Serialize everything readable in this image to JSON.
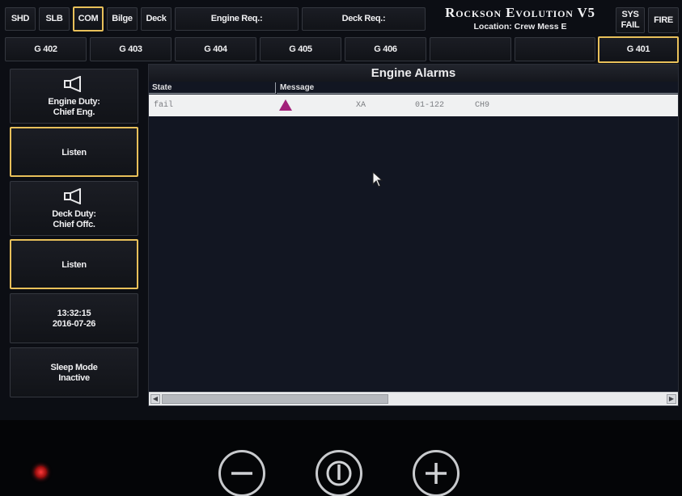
{
  "top_tabs": [
    {
      "label": "SHD",
      "selected": false
    },
    {
      "label": "SLB",
      "selected": false
    },
    {
      "label": "COM",
      "selected": true
    },
    {
      "label": "Bilge",
      "selected": false
    },
    {
      "label": "Deck",
      "selected": false
    }
  ],
  "requests": {
    "engine": "Engine Req.:",
    "deck": "Deck Req.:"
  },
  "brand": {
    "title": "Rockson Evolution V5",
    "location": "Location: Crew Mess E"
  },
  "status_buttons": {
    "sys_fail": "SYS FAIL",
    "fire": "FIRE"
  },
  "groups": [
    {
      "label": "G 402",
      "selected": false
    },
    {
      "label": "G 403",
      "selected": false
    },
    {
      "label": "G 404",
      "selected": false
    },
    {
      "label": "G 405",
      "selected": false
    },
    {
      "label": "G 406",
      "selected": false
    },
    {
      "label": "",
      "selected": false
    },
    {
      "label": "",
      "selected": false
    },
    {
      "label": "G 401",
      "selected": true
    }
  ],
  "sidebar": {
    "engine_duty": "Engine Duty:\nChief Eng.",
    "listen_1": "Listen",
    "deck_duty": "Deck Duty:\nChief Offc.",
    "listen_2": "Listen",
    "datetime": "13:32:15\n2016-07-26",
    "sleep_mode": "Sleep Mode\nInactive"
  },
  "alarms": {
    "title": "Engine Alarms",
    "columns": [
      "State",
      "Message"
    ],
    "rows": [
      {
        "state": "fail",
        "severity_icon": "warning-triangle-icon",
        "code": "XA",
        "location": "01-122",
        "channel": "CH9"
      }
    ]
  },
  "colors": {
    "selected_border": "#e8c05a",
    "alarm_icon": "#a2217a",
    "led": "#ff2a2a"
  },
  "hardware_buttons": [
    "minus-icon",
    "power-icon",
    "plus-icon"
  ]
}
